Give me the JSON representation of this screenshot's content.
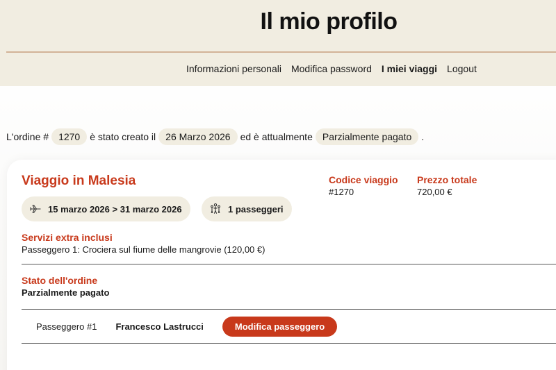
{
  "header": {
    "title": "Il mio profilo",
    "nav": [
      {
        "label": "Informazioni personali"
      },
      {
        "label": "Modifica password"
      },
      {
        "label": "I miei viaggi"
      },
      {
        "label": "Logout"
      }
    ],
    "active_nav": "I miei viaggi"
  },
  "order": {
    "prefix": "L'ordine #",
    "number": "1270",
    "created_text": "è stato creato il",
    "date": "26 Marzo 2026",
    "status_text": "ed è attualmente",
    "status": "Parzialmente pagato",
    "suffix": "."
  },
  "trip": {
    "title": "Viaggio in Malesia",
    "code_label": "Codice viaggio",
    "code": "#1270",
    "price_label": "Prezzo totale",
    "price": "720,00 €",
    "dates": "15 marzo 2026 > 31 marzo 2026",
    "dates_icon": "airplane-icon",
    "passengers": "1 passeggeri",
    "passengers_icon": "group-icon",
    "extras_label": "Servizi extra inclusi",
    "extras_text": "Passeggero 1: Crociera sul fiume delle mangrovie (120,00 €)",
    "status_label": "Stato dell'ordine",
    "status_value": "Parzialmente pagato"
  },
  "passengers": [
    {
      "number_label": "Passeggero #1",
      "name": "Francesco Lastrucci",
      "edit_label": "Modifica passeggero"
    }
  ],
  "colors": {
    "accent": "#c8391b",
    "header_bg": "#f1ede1",
    "header_rule": "#d2b397"
  }
}
